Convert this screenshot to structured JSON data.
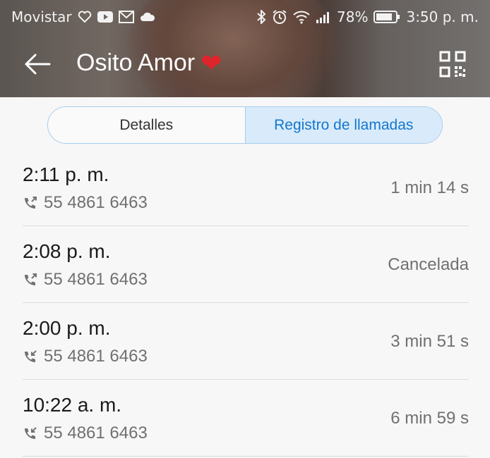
{
  "status_bar": {
    "carrier": "Movistar",
    "battery": "78%",
    "time": "3:50 p. m.",
    "icons": [
      "heart-outline-icon",
      "youtube-icon",
      "gmail-icon",
      "cloud-icon",
      "bluetooth-icon",
      "alarm-icon",
      "wifi-icon",
      "signal-icon",
      "battery-icon"
    ]
  },
  "app_bar": {
    "title": "Osito Amor",
    "emoji": "❤",
    "back_icon": "arrow-back-icon",
    "qr_icon": "qr-code-icon"
  },
  "tabs": [
    {
      "label": "Detalles",
      "active": false
    },
    {
      "label": "Registro de llamadas",
      "active": true
    }
  ],
  "calls": [
    {
      "time": "2:11 p. m.",
      "number": "55 4861 6463",
      "status": "1 min 14 s",
      "direction": "outgoing"
    },
    {
      "time": "2:08 p. m.",
      "number": "55 4861 6463",
      "status": "Cancelada",
      "direction": "outgoing"
    },
    {
      "time": "2:00 p. m.",
      "number": "55 4861 6463",
      "status": "3 min 51 s",
      "direction": "incoming"
    },
    {
      "time": "10:22 a. m.",
      "number": "55 4861 6463",
      "status": "6 min 59 s",
      "direction": "incoming"
    }
  ],
  "colors": {
    "accent": "#1477cf",
    "tab_active_bg": "#d9ebfa",
    "tab_border": "#a6cdee",
    "heart": "#e0242b"
  }
}
